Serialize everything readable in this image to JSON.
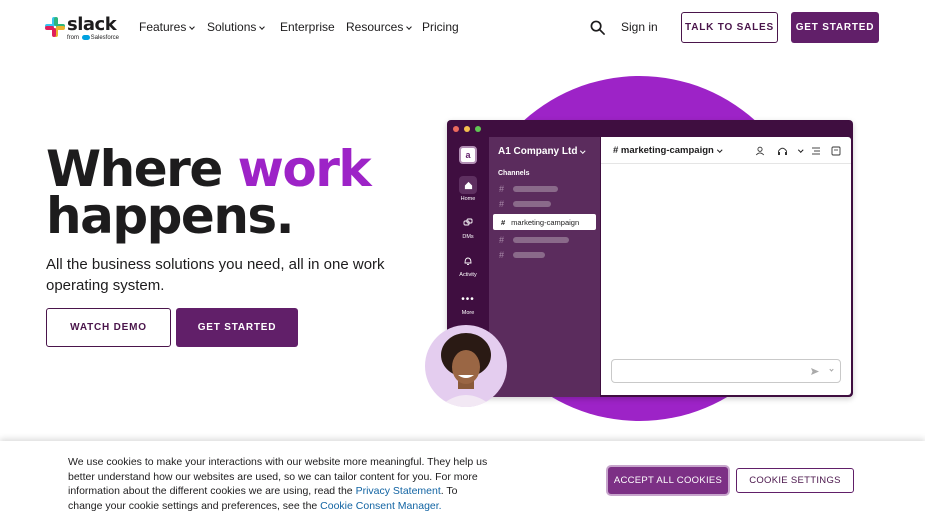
{
  "nav": {
    "logo_text": "slack",
    "logo_sub_prefix": "from",
    "logo_sub_brand": "Salesforce",
    "items": [
      {
        "label": "Features",
        "has_dropdown": true
      },
      {
        "label": "Solutions",
        "has_dropdown": true
      },
      {
        "label": "Enterprise",
        "has_dropdown": false
      },
      {
        "label": "Resources",
        "has_dropdown": true
      },
      {
        "label": "Pricing",
        "has_dropdown": false
      }
    ],
    "search_icon": "search-icon",
    "signin_label": "Sign in",
    "talk_label": "TALK TO SALES",
    "get_started_label": "GET STARTED"
  },
  "hero": {
    "title_word1": "Where",
    "title_accent": "work",
    "title_line2": "happens.",
    "subtitle": "All the business solutions you need, all in one work operating system.",
    "watch_demo_label": "WATCH DEMO",
    "get_started_label": "GET STARTED"
  },
  "app_preview": {
    "workspace_name": "A1 Company Ltd",
    "channels_heading": "Channels",
    "active_channel": "marketing-campaign",
    "channel_title": "# marketing-campaign",
    "rail": [
      {
        "label": "Home",
        "icon": "home-icon"
      },
      {
        "label": "DMs",
        "icon": "dms-icon"
      },
      {
        "label": "Activity",
        "icon": "bell-icon"
      },
      {
        "label": "More",
        "icon": "more-icon"
      }
    ],
    "header_icons": [
      "person-icon",
      "headphones-icon",
      "chevron-down-icon",
      "list-icon",
      "canvas-icon"
    ]
  },
  "cookie": {
    "text_before": "We use cookies to make your interactions with our website more meaningful. They help us better understand how our websites are used, so we can tailor content for you. For more information about the different cookies we are using, read the ",
    "privacy_link": "Privacy Statement",
    "text_middle": ". To change your cookie settings and preferences, see the ",
    "consent_link": "Cookie Consent Manager.",
    "accept_label": "ACCEPT ALL COOKIES",
    "settings_label": "COOKIE SETTINGS"
  },
  "colors": {
    "aubergine": "#611f69",
    "accent_purple": "#9d23c7",
    "app_dark": "#3f0e40",
    "link_blue": "#1264a3"
  }
}
